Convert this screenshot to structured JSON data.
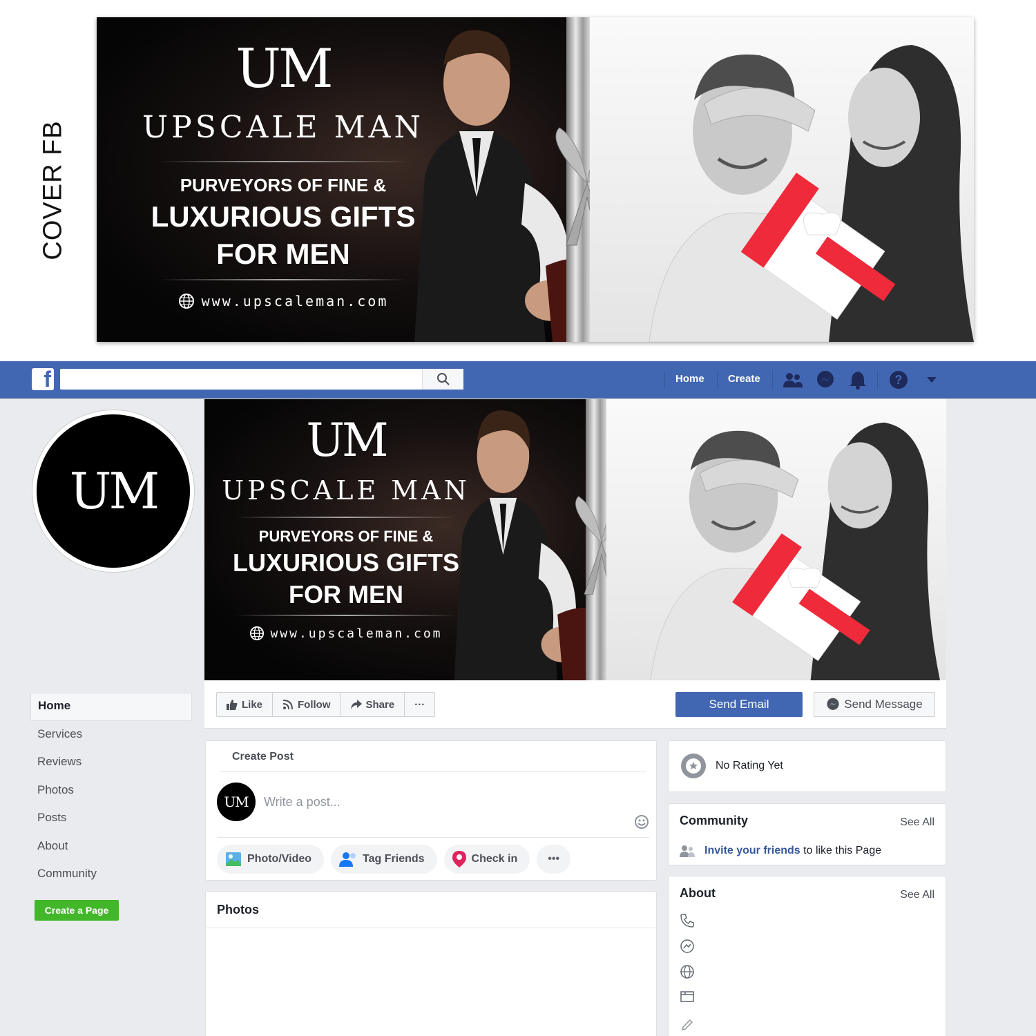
{
  "side_label": "COVER FB",
  "cover": {
    "logo": "UM",
    "brand": "UPSCALE MAN",
    "tagline_1": "PURVEYORS OF FINE &",
    "tagline_2": "LUXURIOUS GIFTS",
    "tagline_3": "FOR MEN",
    "url": "www.upscaleman.com"
  },
  "topbar": {
    "logo_letter": "f",
    "search_placeholder": "",
    "nav": [
      "Home",
      "Create"
    ]
  },
  "profile": {
    "logo": "UM"
  },
  "left_nav": {
    "items": [
      "Home",
      "Services",
      "Reviews",
      "Photos",
      "Posts",
      "About",
      "Community"
    ],
    "active": "Home",
    "create_page": "Create a Page"
  },
  "actions": {
    "like": "Like",
    "follow": "Follow",
    "share": "Share",
    "more": "···",
    "send_email": "Send Email",
    "send_message": "Send Message"
  },
  "create_post": {
    "title": "Create Post",
    "avatar_logo": "UM",
    "placeholder": "Write a post...",
    "buttons": [
      "Photo/Video",
      "Tag Friends",
      "Check in"
    ],
    "more": "•••"
  },
  "photos": {
    "title": "Photos"
  },
  "rating": {
    "text": "No Rating Yet"
  },
  "community": {
    "title": "Community",
    "see_all": "See All",
    "invite_link": "Invite your friends",
    "invite_rest": "to like this Page"
  },
  "about": {
    "title": "About",
    "see_all": "See All",
    "icons": [
      "phone-icon",
      "messenger-icon",
      "globe-icon",
      "category-icon",
      "edit-icon"
    ]
  },
  "colors": {
    "fb_blue": "#4267b2",
    "green": "#42b72a",
    "bg": "#e9ebee"
  }
}
